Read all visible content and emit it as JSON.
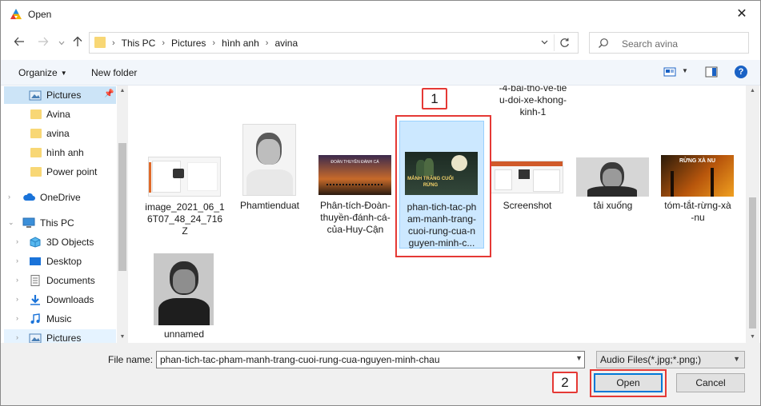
{
  "window": {
    "title": "Open",
    "close_glyph": "✕"
  },
  "address": {
    "crumbs": [
      "This PC",
      "Pictures",
      "hình anh",
      "avina"
    ],
    "separator": "›"
  },
  "search": {
    "placeholder": "Search avina"
  },
  "toolbar": {
    "organize": "Organize",
    "new_folder": "New folder"
  },
  "nav": {
    "items": [
      {
        "label": "Pictures",
        "icon": "pictures-folder-icon",
        "state": "selected",
        "pinned": true
      },
      {
        "label": "Avina",
        "icon": "folder-icon"
      },
      {
        "label": "avina",
        "icon": "folder-icon"
      },
      {
        "label": "hình anh",
        "icon": "folder-icon"
      },
      {
        "label": "Power point",
        "icon": "folder-icon"
      },
      {
        "label": "OneDrive",
        "icon": "cloud-icon",
        "expander": "›"
      },
      {
        "label": "This PC",
        "icon": "computer-icon",
        "expander": "⌄"
      },
      {
        "label": "3D Objects",
        "icon": "cube-icon",
        "expander": "›"
      },
      {
        "label": "Desktop",
        "icon": "desktop-icon",
        "expander": "›"
      },
      {
        "label": "Documents",
        "icon": "document-icon",
        "expander": "›"
      },
      {
        "label": "Downloads",
        "icon": "download-icon",
        "expander": "›"
      },
      {
        "label": "Music",
        "icon": "music-icon",
        "expander": "›"
      },
      {
        "label": "Pictures",
        "icon": "pictures-folder-icon",
        "expander": "›",
        "state": "highlighted"
      }
    ]
  },
  "files": {
    "top_partial": "-4-bai-tho-ve-tie\nu-doi-xe-khong-\nkinh-1",
    "items": [
      {
        "name": "image_2021_06_1\n6T07_48_24_716Z"
      },
      {
        "name": "Phamtienduat"
      },
      {
        "name": "Phân-tích-Đoàn-\nthuyền-đánh-cá-\ncủa-Huy-Cận",
        "thumb_caption": "ĐOÀN THUYỀN ĐÁNH CÁ"
      },
      {
        "name": "phan-tich-tac-ph\nam-manh-trang-\ncuoi-rung-cua-n\nguyen-minh-c...",
        "selected": true,
        "thumb_caption": "MẢNH TRĂNG CUỐI RỪNG"
      },
      {
        "name": "Screenshot"
      },
      {
        "name": "tải xuống"
      },
      {
        "name": "tóm-tắt-rừng-xà\n-nu",
        "thumb_caption": "RỪNG XÀ NU"
      },
      {
        "name": "unnamed"
      }
    ]
  },
  "bottom": {
    "file_name_label": "File name:",
    "file_name_value": "phan-tich-tac-pham-manh-trang-cuoi-rung-cua-nguyen-minh-chau",
    "file_type": "Audio Files(*.jpg;*.png;)",
    "open_label": "Open",
    "cancel_label": "Cancel"
  },
  "annotations": {
    "step1": "1",
    "step2": "2"
  },
  "colors": {
    "selection": "#cce8ff",
    "accent": "#0078d7",
    "annotation": "#e53935"
  }
}
